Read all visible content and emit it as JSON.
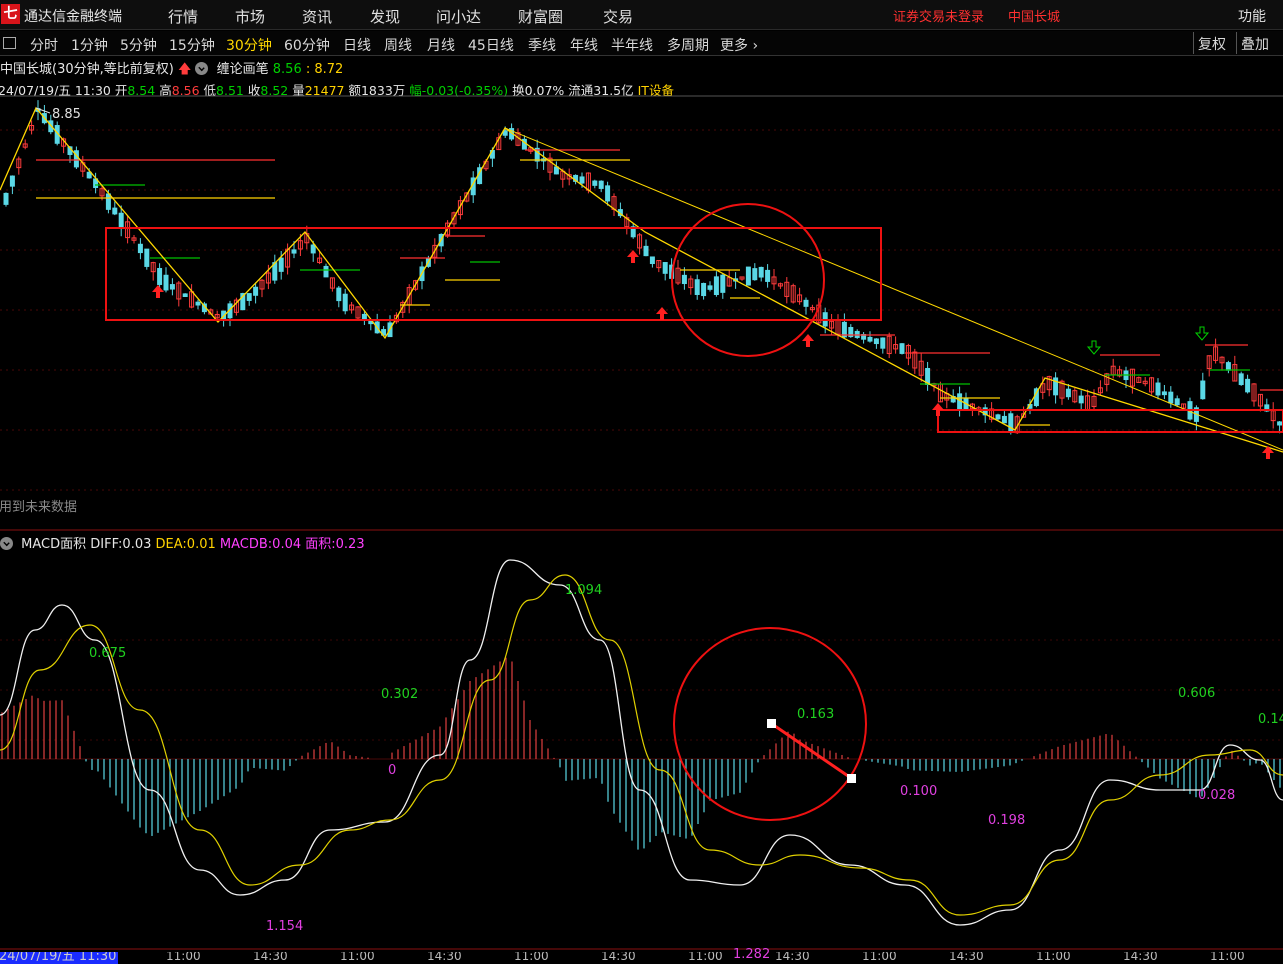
{
  "menubar": {
    "logo": "七",
    "app_title": "通达信金融终端",
    "menus": [
      "行情",
      "市场",
      "资讯",
      "发现",
      "问小达",
      "财富圈",
      "交易"
    ],
    "login_status": "证券交易未登录",
    "stock_name": "中国长城",
    "function_label": "功能"
  },
  "periodbar": {
    "periods": [
      "分时",
      "1分钟",
      "5分钟",
      "15分钟",
      "30分钟",
      "60分钟",
      "日线",
      "周线",
      "月线",
      "45日线",
      "季线",
      "年线",
      "半年线",
      "多周期",
      "更多 ›"
    ],
    "active": "30分钟",
    "right_buttons": [
      "复权",
      "叠加"
    ]
  },
  "chart_header": {
    "title": "中国长城(30分钟,等比前复权)",
    "indicator": "缠论画笔",
    "indicator_v1": "8.56",
    "indicator_v2": ": 8.72"
  },
  "bar_info": {
    "date": "24/07/19/五 11:30",
    "open_label": "开",
    "open": "8.54",
    "high_label": "高",
    "high": "8.56",
    "low_label": "低",
    "low": "8.51",
    "close_label": "收",
    "close": "8.52",
    "vol_label": "量",
    "vol": "21477",
    "amt": "额1833万",
    "chg": "幅-0.03(-0.35%)",
    "turnover": "换0.07%",
    "float": "流通31.5亿",
    "sector": "IT设备"
  },
  "price_labels": {
    "high_mark": "8.85"
  },
  "future_note": "用到未来数据",
  "macd": {
    "name": "MACD面积",
    "diff_label": "DIFF:",
    "diff": "0.03",
    "dea_label": "DEA:",
    "dea": "0.01",
    "macdb_label": "MACDB:",
    "macdb": "0.04",
    "area_label": "面积:",
    "area": "0.23",
    "annotations_green": [
      "0.675",
      "0.302",
      "1.094",
      "0.163",
      "0.606",
      "0.14"
    ],
    "annotations_magenta": [
      "0",
      "1.154",
      "0.100",
      "0.198",
      "0.028",
      "1.282"
    ]
  },
  "time_axis": {
    "date": "24/07/19/五 11:30",
    "ticks": [
      "11:00",
      "14:30",
      "11:00",
      "14:30",
      "11:00",
      "14:30",
      "11:00",
      "14:30",
      "11:00",
      "14:30",
      "11:00",
      "14:30",
      "11:00"
    ]
  },
  "colors": {
    "up": "#ff3c3c",
    "down": "#5ad8e6",
    "yellow": "#ffd800",
    "bg": "#000000",
    "annot_red": "#ee1111"
  },
  "chart_data": [
    {
      "type": "candlestick",
      "title": "中国长城(30分钟,等比前复权)",
      "annotations": [
        "8.85"
      ],
      "zigzag_pivots": [
        "8.85",
        "low",
        "high",
        "low",
        "high",
        "low",
        "low",
        "high",
        "high",
        "low"
      ],
      "ohlc_last": {
        "open": 8.54,
        "high": 8.56,
        "low": 8.51,
        "close": 8.52
      }
    },
    {
      "type": "bar",
      "title": "MACD面积",
      "series": [
        {
          "name": "DIFF",
          "values": [
            0.03
          ]
        },
        {
          "name": "DEA",
          "values": [
            0.01
          ]
        },
        {
          "name": "MACDB",
          "values": [
            0.04
          ]
        }
      ],
      "area_values": [
        0.675,
        0.302,
        1.094,
        0.163,
        0.606,
        0.14,
        0,
        1.154,
        0.1,
        0.198,
        0.028,
        1.282
      ]
    }
  ]
}
